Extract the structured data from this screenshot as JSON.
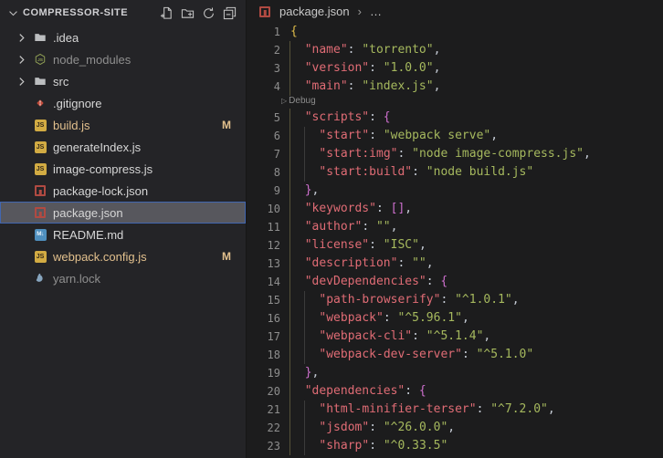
{
  "colors": {
    "editor_bg": "#1c1c1d",
    "sidebar_bg": "#242427",
    "sidebar_border": "#161616",
    "header_text": "#d0d0d3",
    "item_text": "#d6d6d6",
    "item_dim": "#8f8f8f",
    "item_modified": "#e2c08d",
    "selection_bg": "#57575d",
    "selection_border": "#4166b0",
    "icon_gray": "#c8c8c8",
    "line_number": "#8e8e8e",
    "breadcrumb_text": "#c9c9c9",
    "breadcrumb_sep": "#999999",
    "codelens": "#8d8d8d",
    "syn_key": "#e06c75",
    "syn_string": "#a6b95e",
    "syn_punct": "#c6ccd6",
    "bracket_gold": "#e0bd4a",
    "bracket_orchid": "#ce70ce",
    "guide_outer": "#555138",
    "guide_inner": "#3b3b3b",
    "js_icon_bg": "#d2ab43",
    "npm_icon": "#b04a42",
    "md_icon_bg": "#4f8fbe",
    "git_icon": "#c04b3b",
    "node_icon": "#90a055",
    "yarn_icon": "#87a5be",
    "folder_icon": "#bcbec0"
  },
  "sidebar": {
    "title": "COMPRESSOR-SITE",
    "actions": [
      {
        "name": "new-file"
      },
      {
        "name": "new-folder"
      },
      {
        "name": "refresh"
      },
      {
        "name": "collapse-all"
      }
    ],
    "items": [
      {
        "label": ".idea",
        "icon": "folder",
        "folder": true
      },
      {
        "label": "node_modules",
        "icon": "node",
        "folder": true,
        "dim": true
      },
      {
        "label": "src",
        "icon": "folder",
        "folder": true
      },
      {
        "label": ".gitignore",
        "icon": "git"
      },
      {
        "label": "build.js",
        "icon": "js",
        "modified": true,
        "badge": "M"
      },
      {
        "label": "generateIndex.js",
        "icon": "js"
      },
      {
        "label": "image-compress.js",
        "icon": "js"
      },
      {
        "label": "package-lock.json",
        "icon": "npm"
      },
      {
        "label": "package.json",
        "icon": "npm",
        "selected": true
      },
      {
        "label": "README.md",
        "icon": "md"
      },
      {
        "label": "webpack.config.js",
        "icon": "js",
        "modified": true,
        "badge": "M"
      },
      {
        "label": "yarn.lock",
        "icon": "yarn",
        "dim": true
      }
    ]
  },
  "editor": {
    "breadcrumb": {
      "icon": "npm",
      "file": "package.json",
      "separator": "›",
      "ellipsis": "…"
    },
    "rows": [
      {
        "kind": "code",
        "n": 1,
        "ind": 0,
        "tok": [
          [
            "{",
            "b1"
          ]
        ]
      },
      {
        "kind": "code",
        "n": 2,
        "ind": 1,
        "tok": [
          [
            "\"name\"",
            "k"
          ],
          [
            ": ",
            "p"
          ],
          [
            "\"torrento\"",
            "s"
          ],
          [
            ",",
            "p"
          ]
        ]
      },
      {
        "kind": "code",
        "n": 3,
        "ind": 1,
        "tok": [
          [
            "\"version\"",
            "k"
          ],
          [
            ": ",
            "p"
          ],
          [
            "\"1.0.0\"",
            "s"
          ],
          [
            ",",
            "p"
          ]
        ]
      },
      {
        "kind": "code",
        "n": 4,
        "ind": 1,
        "tok": [
          [
            "\"main\"",
            "k"
          ],
          [
            ": ",
            "p"
          ],
          [
            "\"index.js\"",
            "s"
          ],
          [
            ",",
            "p"
          ]
        ]
      },
      {
        "kind": "lens",
        "label": "Debug"
      },
      {
        "kind": "code",
        "n": 5,
        "ind": 1,
        "tok": [
          [
            "\"scripts\"",
            "k"
          ],
          [
            ": ",
            "p"
          ],
          [
            "{",
            "b2"
          ]
        ]
      },
      {
        "kind": "code",
        "n": 6,
        "ind": 2,
        "tok": [
          [
            "\"start\"",
            "k"
          ],
          [
            ": ",
            "p"
          ],
          [
            "\"webpack serve\"",
            "s"
          ],
          [
            ",",
            "p"
          ]
        ]
      },
      {
        "kind": "code",
        "n": 7,
        "ind": 2,
        "tok": [
          [
            "\"start:img\"",
            "k"
          ],
          [
            ": ",
            "p"
          ],
          [
            "\"node image-compress.js\"",
            "s"
          ],
          [
            ",",
            "p"
          ]
        ]
      },
      {
        "kind": "code",
        "n": 8,
        "ind": 2,
        "tok": [
          [
            "\"start:build\"",
            "k"
          ],
          [
            ": ",
            "p"
          ],
          [
            "\"node build.js\"",
            "s"
          ]
        ]
      },
      {
        "kind": "code",
        "n": 9,
        "ind": 1,
        "tok": [
          [
            "}",
            "b2"
          ],
          [
            ",",
            "p"
          ]
        ]
      },
      {
        "kind": "code",
        "n": 10,
        "ind": 1,
        "tok": [
          [
            "\"keywords\"",
            "k"
          ],
          [
            ": ",
            "p"
          ],
          [
            "[]",
            "b2"
          ],
          [
            ",",
            "p"
          ]
        ]
      },
      {
        "kind": "code",
        "n": 11,
        "ind": 1,
        "tok": [
          [
            "\"author\"",
            "k"
          ],
          [
            ": ",
            "p"
          ],
          [
            "\"\"",
            "s"
          ],
          [
            ",",
            "p"
          ]
        ]
      },
      {
        "kind": "code",
        "n": 12,
        "ind": 1,
        "tok": [
          [
            "\"license\"",
            "k"
          ],
          [
            ": ",
            "p"
          ],
          [
            "\"ISC\"",
            "s"
          ],
          [
            ",",
            "p"
          ]
        ]
      },
      {
        "kind": "code",
        "n": 13,
        "ind": 1,
        "tok": [
          [
            "\"description\"",
            "k"
          ],
          [
            ": ",
            "p"
          ],
          [
            "\"\"",
            "s"
          ],
          [
            ",",
            "p"
          ]
        ]
      },
      {
        "kind": "code",
        "n": 14,
        "ind": 1,
        "tok": [
          [
            "\"devDependencies\"",
            "k"
          ],
          [
            ": ",
            "p"
          ],
          [
            "{",
            "b2"
          ]
        ]
      },
      {
        "kind": "code",
        "n": 15,
        "ind": 2,
        "tok": [
          [
            "\"path-browserify\"",
            "k"
          ],
          [
            ": ",
            "p"
          ],
          [
            "\"^1.0.1\"",
            "s"
          ],
          [
            ",",
            "p"
          ]
        ]
      },
      {
        "kind": "code",
        "n": 16,
        "ind": 2,
        "tok": [
          [
            "\"webpack\"",
            "k"
          ],
          [
            ": ",
            "p"
          ],
          [
            "\"^5.96.1\"",
            "s"
          ],
          [
            ",",
            "p"
          ]
        ]
      },
      {
        "kind": "code",
        "n": 17,
        "ind": 2,
        "tok": [
          [
            "\"webpack-cli\"",
            "k"
          ],
          [
            ": ",
            "p"
          ],
          [
            "\"^5.1.4\"",
            "s"
          ],
          [
            ",",
            "p"
          ]
        ]
      },
      {
        "kind": "code",
        "n": 18,
        "ind": 2,
        "tok": [
          [
            "\"webpack-dev-server\"",
            "k"
          ],
          [
            ": ",
            "p"
          ],
          [
            "\"^5.1.0\"",
            "s"
          ]
        ]
      },
      {
        "kind": "code",
        "n": 19,
        "ind": 1,
        "tok": [
          [
            "}",
            "b2"
          ],
          [
            ",",
            "p"
          ]
        ]
      },
      {
        "kind": "code",
        "n": 20,
        "ind": 1,
        "tok": [
          [
            "\"dependencies\"",
            "k"
          ],
          [
            ": ",
            "p"
          ],
          [
            "{",
            "b2"
          ]
        ]
      },
      {
        "kind": "code",
        "n": 21,
        "ind": 2,
        "tok": [
          [
            "\"html-minifier-terser\"",
            "k"
          ],
          [
            ": ",
            "p"
          ],
          [
            "\"^7.2.0\"",
            "s"
          ],
          [
            ",",
            "p"
          ]
        ]
      },
      {
        "kind": "code",
        "n": 22,
        "ind": 2,
        "tok": [
          [
            "\"jsdom\"",
            "k"
          ],
          [
            ": ",
            "p"
          ],
          [
            "\"^26.0.0\"",
            "s"
          ],
          [
            ",",
            "p"
          ]
        ]
      },
      {
        "kind": "code",
        "n": 23,
        "ind": 2,
        "tok": [
          [
            "\"sharp\"",
            "k"
          ],
          [
            ": ",
            "p"
          ],
          [
            "\"^0.33.5\"",
            "s"
          ]
        ]
      }
    ]
  }
}
